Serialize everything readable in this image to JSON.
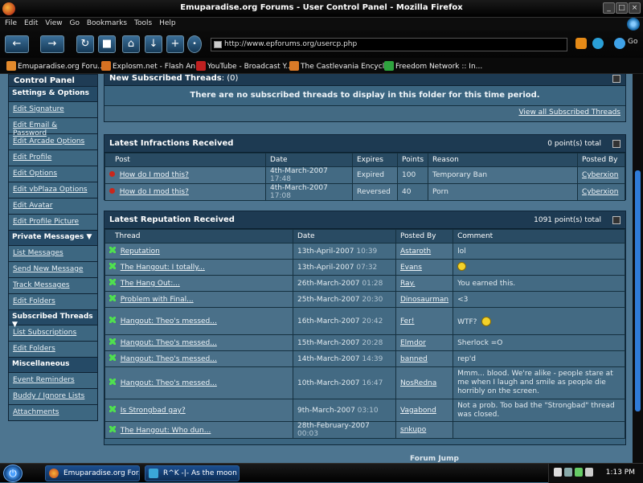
{
  "window": {
    "title": "Emuparadise.org Forums - User Control Panel - Mozilla Firefox"
  },
  "menu": [
    "File",
    "Edit",
    "View",
    "Go",
    "Bookmarks",
    "Tools",
    "Help"
  ],
  "nav": {
    "url": "http://www.epforums.org/usercp.php"
  },
  "bookmarks": [
    "Emuparadise.org Foru...",
    "Explosm.net - Flash An...",
    "YouTube - Broadcast Y...",
    "The Castlevania Encycl...",
    "Freedom Network :: In..."
  ],
  "sidebar": {
    "title": "Control Panel",
    "settings_header": "Settings & Options",
    "settings": [
      "Edit Signature",
      "Edit Email & Password",
      "Edit Arcade Options",
      "Edit Profile",
      "Edit Options",
      "Edit vbPlaza Options",
      "Edit Avatar",
      "Edit Profile Picture"
    ],
    "pm_header": "Private Messages",
    "pm": [
      "List Messages",
      "Send New Message",
      "Track Messages",
      "Edit Folders"
    ],
    "subs_header": "Subscribed Threads",
    "subs": [
      "List Subscriptions",
      "Edit Folders"
    ],
    "misc_header": "Miscellaneous",
    "misc": [
      "Event Reminders",
      "Buddy / Ignore Lists",
      "Attachments"
    ]
  },
  "subscribed": {
    "title": "New Subscribed Threads",
    "count": ": (0)",
    "empty_msg": "There are no subscribed threads to display in this folder for this time period.",
    "view_all": "View all Subscribed Threads"
  },
  "infractions": {
    "title": "Latest Infractions Received",
    "total": "0 point(s) total",
    "columns": [
      "Post",
      "Date",
      "Expires",
      "Points",
      "Reason",
      "Posted By"
    ],
    "rows": [
      {
        "post": "How do I mod this?",
        "date": "4th-March-2007",
        "time": "17:48",
        "expires": "Expired",
        "points": "100",
        "reason": "Temporary Ban",
        "by": "Cyberxion"
      },
      {
        "post": "How do I mod this?",
        "date": "4th-March-2007",
        "time": "17:08",
        "expires": "Reversed",
        "points": "40",
        "reason": "Porn",
        "by": "Cyberxion"
      }
    ]
  },
  "reputation": {
    "title": "Latest Reputation Received",
    "total": "1091 point(s) total",
    "columns": [
      "Thread",
      "Date",
      "Posted By",
      "Comment"
    ],
    "rows": [
      {
        "thread": "Reputation",
        "date": "13th-April-2007",
        "time": "10:39",
        "by": "Astaroth",
        "comment": "lol"
      },
      {
        "thread": "The Hangout: I totally...",
        "date": "13th-April-2007",
        "time": "07:32",
        "by": "Evans",
        "comment": ""
      },
      {
        "thread": "The Hang Out:...",
        "date": "26th-March-2007",
        "time": "01:28",
        "by": "Ray.",
        "comment": "You earned this."
      },
      {
        "thread": "Problem with Final...",
        "date": "25th-March-2007",
        "time": "20:30",
        "by": "Dinosaurman",
        "comment": "<3"
      },
      {
        "thread": "Hangout: Theo's messed...",
        "date": "16th-March-2007",
        "time": "20:42",
        "by": "Fer!",
        "comment": "WTF?"
      },
      {
        "thread": "Hangout: Theo's messed...",
        "date": "15th-March-2007",
        "time": "20:28",
        "by": "Elmdor",
        "comment": "Sherlock =O"
      },
      {
        "thread": "Hangout: Theo's messed...",
        "date": "14th-March-2007",
        "time": "14:39",
        "by": "banned",
        "comment": "rep'd"
      },
      {
        "thread": "Hangout: Theo's messed...",
        "date": "10th-March-2007",
        "time": "16:47",
        "by": "NosRedna",
        "comment": "Mmm... blood. We're alike - people stare at me when I laugh and smile as people die horribly on the screen."
      },
      {
        "thread": "Is Strongbad gay?",
        "date": "9th-March-2007",
        "time": "03:10",
        "by": "Vagabond",
        "comment": "Not a prob. Too bad the \"Strongbad\" thread was closed."
      },
      {
        "thread": "The Hangout: Who dun...",
        "date": "28th-February-2007",
        "time": "00:03",
        "by": "snkupo",
        "comment": ""
      }
    ]
  },
  "footer": {
    "forum_jump": "Forum Jump"
  },
  "taskbar": {
    "tasks": [
      "Emuparadise.org For...",
      "R^K -|- As the moon ..."
    ],
    "clock": "1:13 PM"
  }
}
